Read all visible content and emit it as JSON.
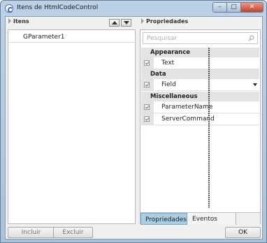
{
  "window": {
    "title": "Itens de HtmlCodeControl",
    "minimize_glyph": "–",
    "maximize_glyph": "□",
    "close_glyph": "✕"
  },
  "items_panel": {
    "header": "Itens",
    "items": [
      "GParameter1"
    ]
  },
  "properties_panel": {
    "header": "Propriedades",
    "search_placeholder": "Pesquisar",
    "categories": [
      {
        "name": "Appearance",
        "properties": [
          {
            "name": "Text",
            "value": ""
          }
        ]
      },
      {
        "name": "Data",
        "properties": [
          {
            "name": "Field",
            "value": ""
          }
        ]
      },
      {
        "name": "Miscellaneous",
        "properties": [
          {
            "name": "ParameterName",
            "value": ""
          },
          {
            "name": "ServerCommand",
            "value": ""
          }
        ]
      }
    ],
    "tabs": [
      "Propriedades",
      "Eventos"
    ],
    "active_tab": "Propriedades"
  },
  "buttons": {
    "incluir": "Incluir",
    "excluir": "Excluir",
    "ok": "OK"
  }
}
